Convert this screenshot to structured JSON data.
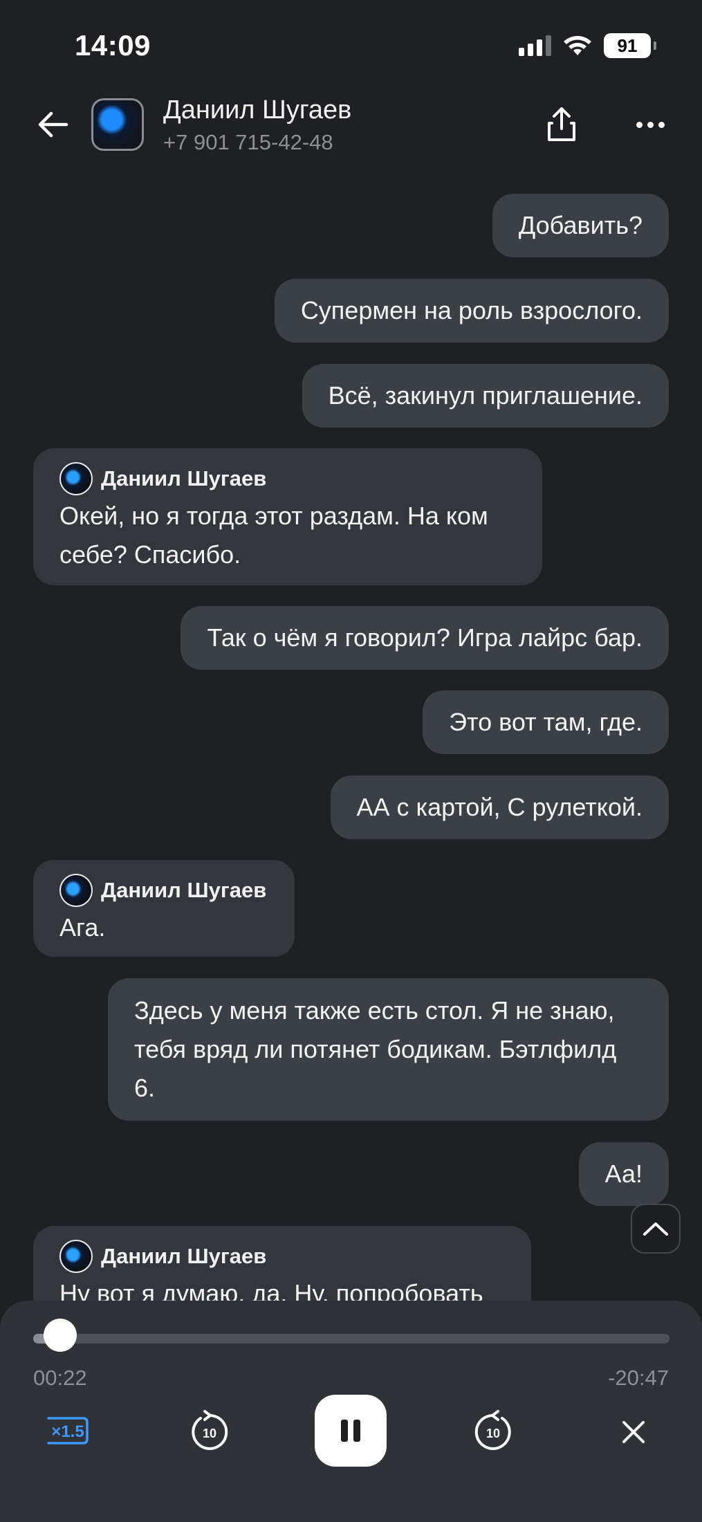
{
  "status": {
    "time": "14:09",
    "battery": "91"
  },
  "header": {
    "name": "Даниил Шугаев",
    "phone": "+7 901 715-42-48"
  },
  "messages": [
    {
      "dir": "out",
      "text": "Добавить?"
    },
    {
      "dir": "out",
      "text": "Супермен на роль взрослого."
    },
    {
      "dir": "out",
      "text": "Всё, закинул приглашение."
    },
    {
      "dir": "in",
      "sender": "Даниил Шугаев",
      "text": "Окей, но я тогда этот раздам. На ком себе? Спасибо."
    },
    {
      "dir": "out",
      "text": "Так о чём я говорил? Игра лайрс бар."
    },
    {
      "dir": "out",
      "text": "Это вот там, где."
    },
    {
      "dir": "out",
      "text": "АА с картой, С рулеткой."
    },
    {
      "dir": "in",
      "sender": "Даниил Шугаев",
      "text": "Ага."
    },
    {
      "dir": "out",
      "text": "Здесь у меня также есть стол. Я не знаю, тебя вряд ли потянет бодикам. Бэтлфилд 6."
    },
    {
      "dir": "out",
      "text": "Аа!"
    },
    {
      "dir": "in",
      "sender": "Даниил Шугаев",
      "text": "Ну вот я думаю, да. Ну, попробовать"
    }
  ],
  "player": {
    "elapsed": "00:22",
    "remaining": "-20:47",
    "progress": 0.017,
    "speed_label": "×1.5",
    "rewind_label": "10",
    "forward_label": "10",
    "accent_color": "#3d9bff"
  }
}
